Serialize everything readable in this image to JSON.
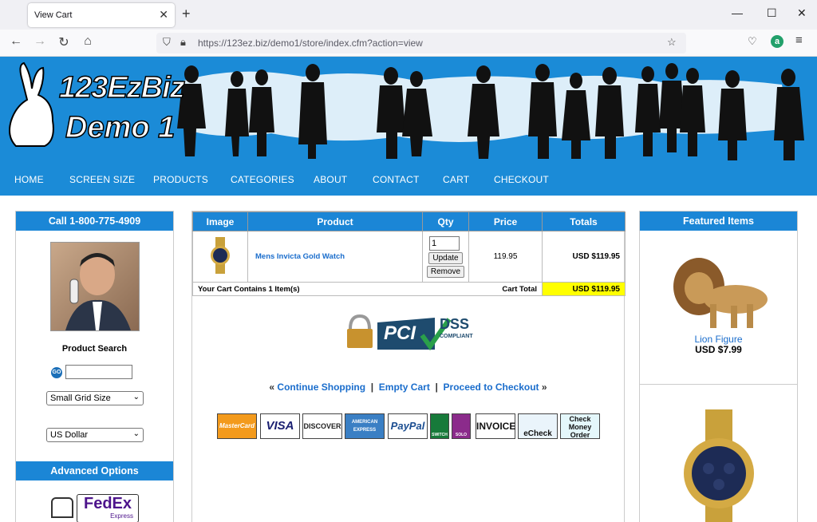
{
  "browser": {
    "tab_title": "View Cart",
    "url": "https://123ez.biz/demo1/store/index.cfm?action=view",
    "extension_letter": "a"
  },
  "site": {
    "logo_line1": "123EzBiz",
    "logo_line2": "Demo 1",
    "menu": [
      "HOME",
      "SCREEN SIZE",
      "PRODUCTS",
      "CATEGORIES",
      "ABOUT",
      "CONTACT",
      "CART",
      "CHECKOUT"
    ]
  },
  "left_sidebar": {
    "phone_header": "Call 1-800-775-4909",
    "product_search_label": "Product Search",
    "go_label": "GO",
    "grid_size_value": "Small Grid Size",
    "currency_value": "US Dollar",
    "advanced_header": "Advanced Options",
    "fedex_text": "FedEx",
    "fedex_sub": "Express"
  },
  "cart": {
    "headers": [
      "Image",
      "Product",
      "Qty",
      "Price",
      "Totals"
    ],
    "item": {
      "product": "Mens Invicta Gold Watch",
      "qty": "1",
      "update_label": "Update",
      "remove_label": "Remove",
      "price": "119.95",
      "total": "USD $119.95"
    },
    "summary": "Your Cart Contains 1 Item(s)",
    "cart_total_label": "Cart Total",
    "cart_total_value": "USD $119.95",
    "pci_text": "PCI",
    "dss_text": "DSS",
    "compliant_text": "COMPLIANT",
    "continue_label": "Continue Shopping",
    "empty_label": "Empty Cart",
    "checkout_label": "Proceed to Checkout",
    "payment_methods": [
      "MasterCard",
      "VISA",
      "DISCOVER",
      "AMERICAN EXPRESS",
      "PayPal",
      "SWITCH",
      "SOLO",
      "INVOICE",
      "eCheck",
      "Check Money Order"
    ]
  },
  "featured": {
    "header": "Featured Items",
    "item1_name": "Lion Figure",
    "item1_price": "USD $7.99"
  },
  "colors": {
    "brand_blue": "#1b8bd7",
    "link_blue": "#1a6dcc",
    "total_highlight": "#ffff00"
  }
}
